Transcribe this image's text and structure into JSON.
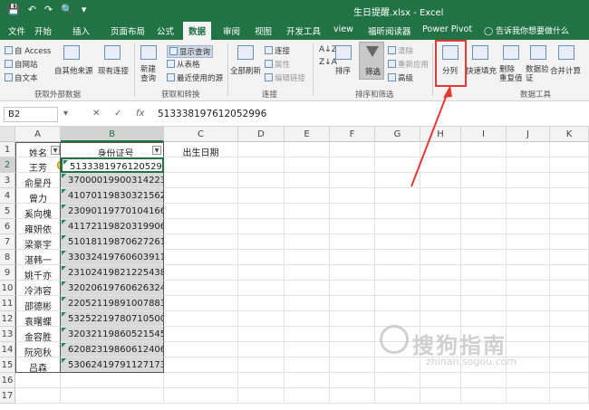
{
  "window_title": "生日提醒.xlsx  -  Excel",
  "tabs": [
    "文件",
    "开始",
    "插入",
    "页面布局",
    "公式",
    "数据",
    "审阅",
    "视图",
    "开发工具",
    "view",
    "福昕阅读器",
    "Power Pivot"
  ],
  "tell_me": "告诉我你想要做什么",
  "ribbon": {
    "get_external": {
      "access": "自 Access",
      "web": "自网站",
      "text": "自文本",
      "other": "自其他来源",
      "existing": "现有连接",
      "label": "获取外部数据"
    },
    "get_transform": {
      "new_query": "新建\n查询",
      "show_queries": "显示查询",
      "from_table": "从表格",
      "recent": "最近使用的源",
      "label": "获取和转换"
    },
    "connections": {
      "refresh_all": "全部刷新",
      "connections": "连接",
      "properties": "属性",
      "edit_links": "编辑链接",
      "label": "连接"
    },
    "sort_filter": {
      "sort": "排序",
      "filter": "筛选",
      "clear": "清除",
      "reapply": "重新应用",
      "advanced": "高级",
      "label": "排序和筛选"
    },
    "data_tools": {
      "split": "分列",
      "flash_fill": "快速填充",
      "remove_dup": "删除\n重复值",
      "validate": "数据验\n证",
      "consolidate": "合并计算",
      "label": "数据工具"
    }
  },
  "formula_bar": {
    "name_box": "B2",
    "formula": "513338197612052996"
  },
  "columns": [
    "A",
    "B",
    "C",
    "D",
    "E",
    "F",
    "G",
    "H",
    "I",
    "J",
    "K"
  ],
  "header_row": {
    "name": "姓名",
    "id": "身份证号",
    "birthday": "出生日期"
  },
  "rows": [
    {
      "name": "王芳",
      "id": "513338197612052996"
    },
    {
      "name": "俞星丹",
      "id": "370000199003142237"
    },
    {
      "name": "曾力",
      "id": "410701198303215621"
    },
    {
      "name": "奚向槐",
      "id": "230901197701041666"
    },
    {
      "name": "雍妍依",
      "id": "411721198203199069"
    },
    {
      "name": "梁豪宇",
      "id": "510181198706272615"
    },
    {
      "name": "湛韩一",
      "id": "330324197606039117"
    },
    {
      "name": "姚千亦",
      "id": "231024198212254389"
    },
    {
      "name": "冷沛容",
      "id": "32020619760626324X"
    },
    {
      "name": "邵德彬",
      "id": "220521198910078832"
    },
    {
      "name": "袁曙蝶",
      "id": "53252219780710500X"
    },
    {
      "name": "金容胜",
      "id": "320321198605215450"
    },
    {
      "name": "阮宛秋",
      "id": "620823198606124068"
    },
    {
      "name": "吕森",
      "id": "530624197911271733"
    }
  ],
  "row_numbers": [
    "1",
    "2",
    "3",
    "4",
    "5",
    "6",
    "7",
    "8",
    "9",
    "10",
    "11",
    "12",
    "13",
    "14",
    "15",
    "16",
    "17"
  ],
  "watermark": {
    "main": "搜狗指南",
    "sub": "zhinan.sogou.com"
  }
}
